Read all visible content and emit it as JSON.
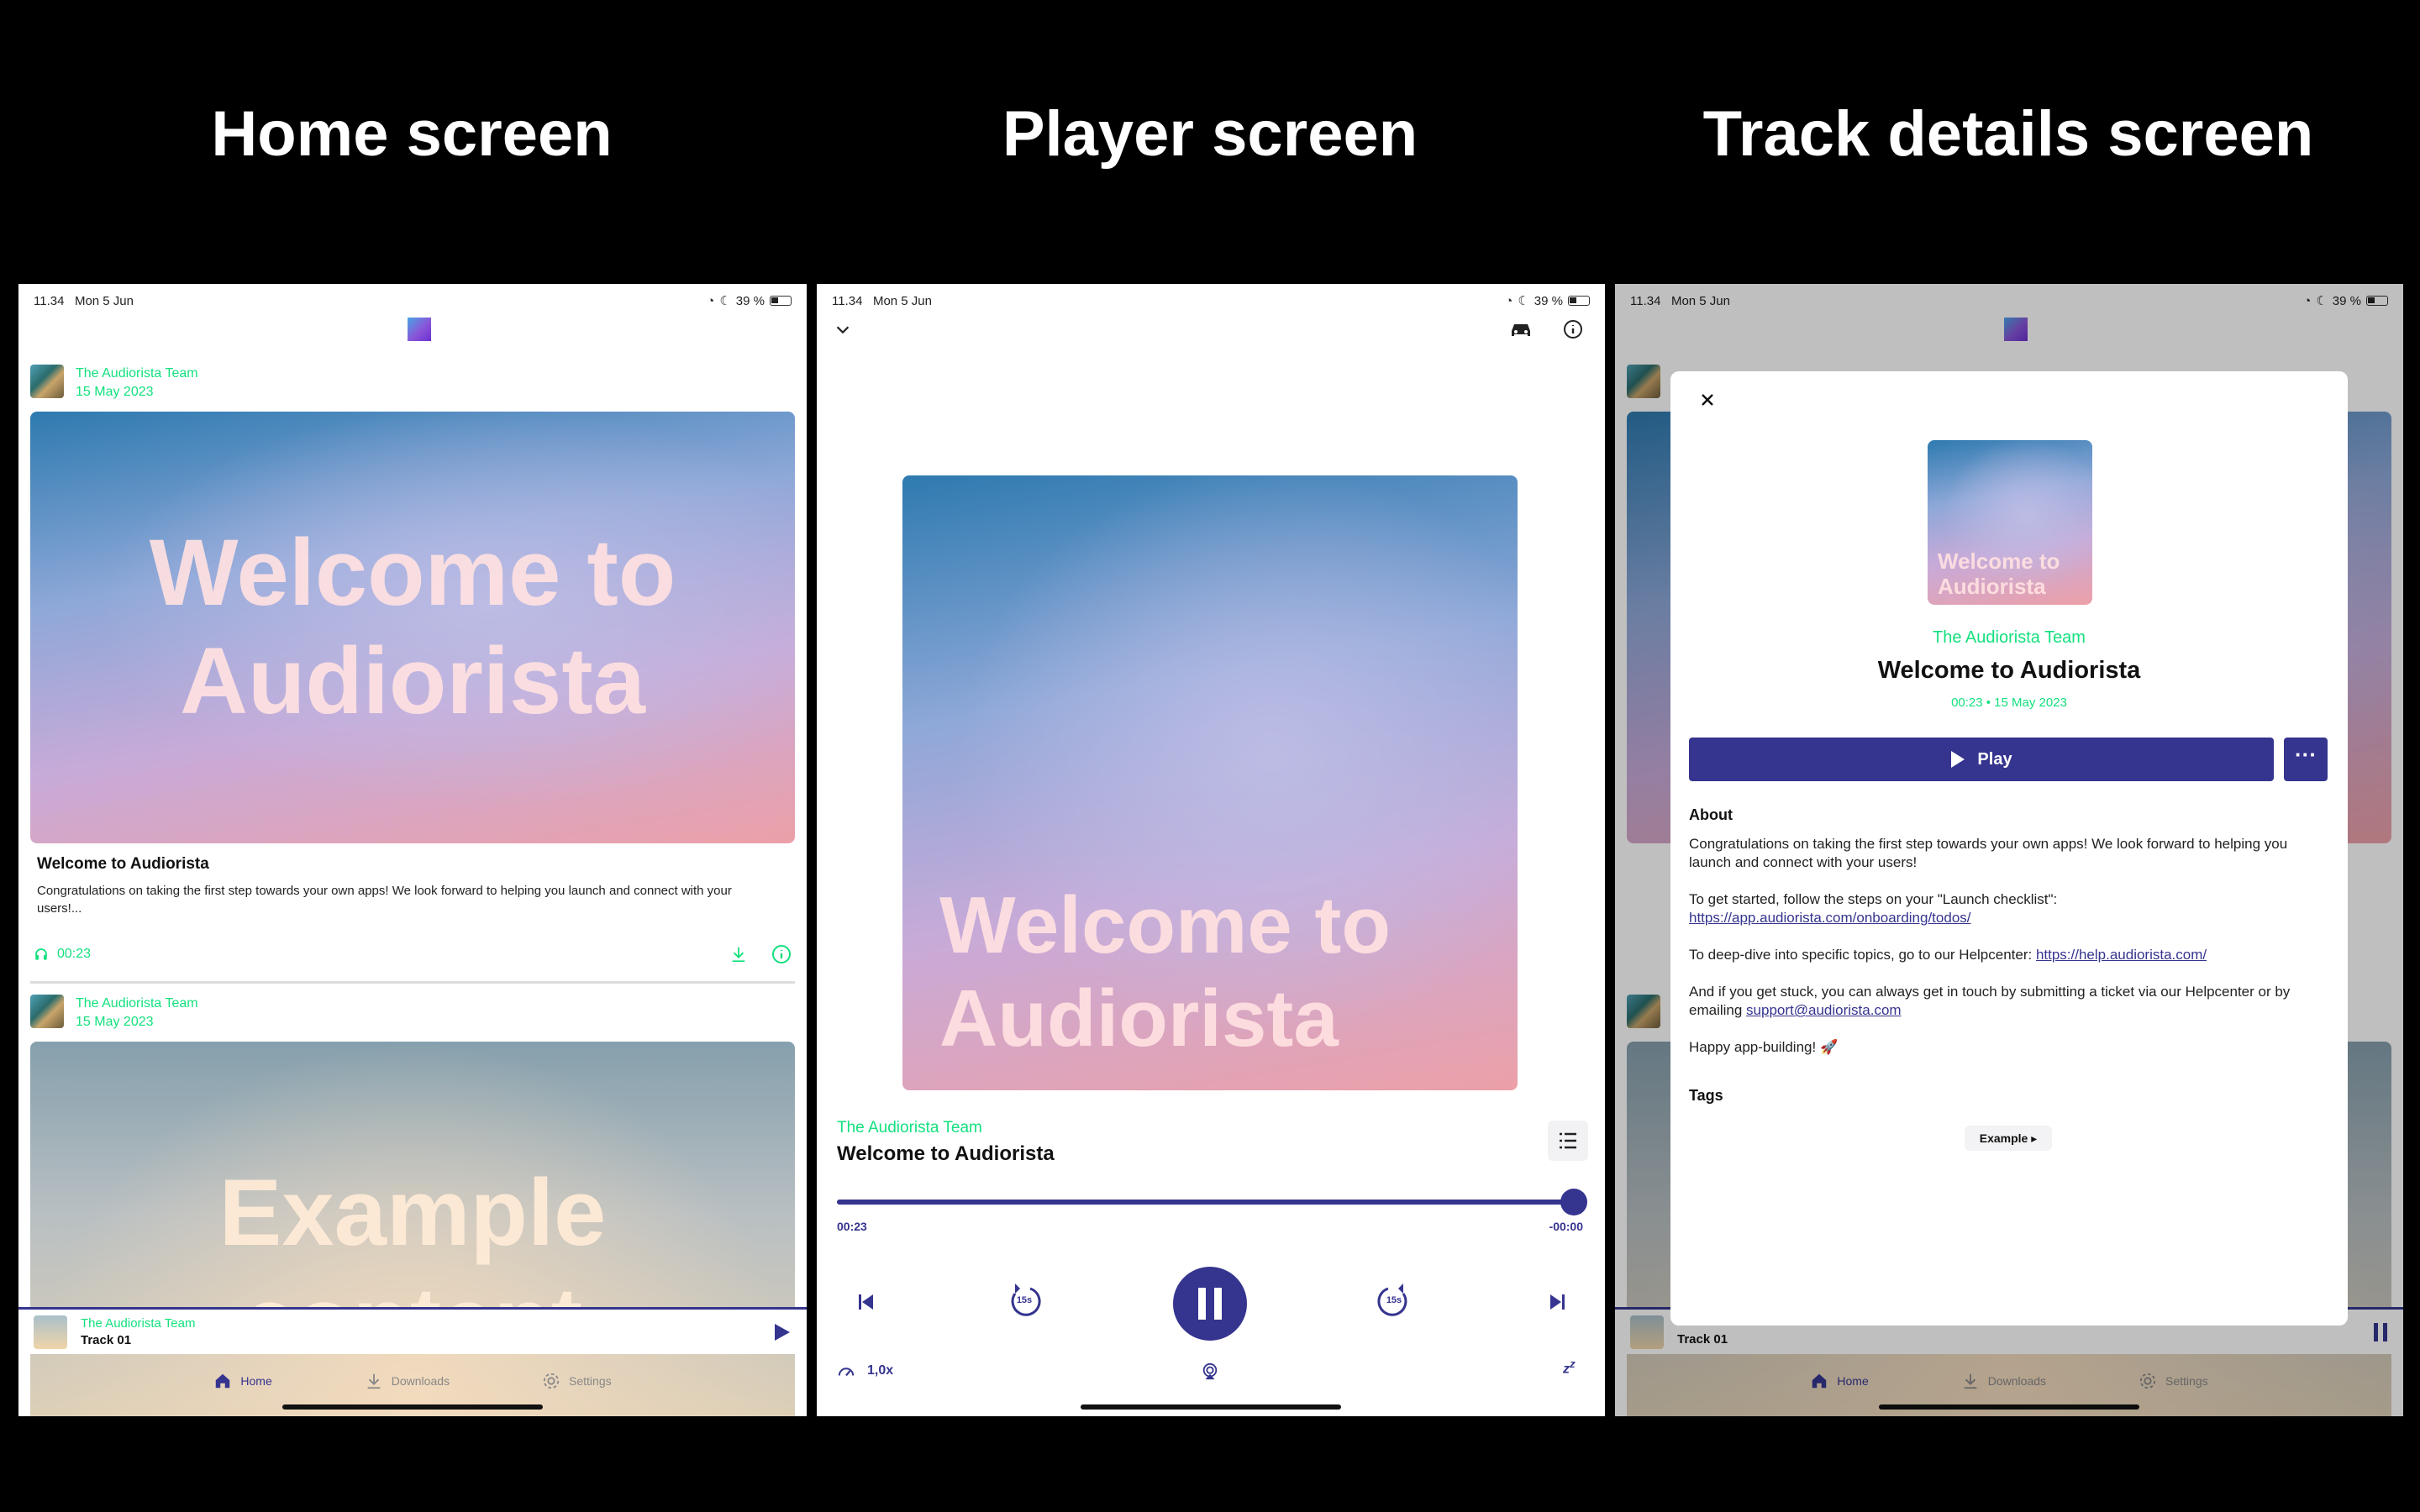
{
  "headings": {
    "home": "Home screen",
    "player": "Player screen",
    "details": "Track details screen"
  },
  "status_bar": {
    "time": "11.34",
    "date": "Mon 5 Jun",
    "battery": "39 %"
  },
  "home": {
    "posts": [
      {
        "author": "The Audiorista Team",
        "date": "15 May 2023",
        "cover_text": "Welcome to Audiorista",
        "title": "Welcome to Audiorista",
        "description": "Congratulations on taking the first step towards your own apps! We look forward to helping you launch and connect with your users!...",
        "duration": "00:23"
      },
      {
        "author": "The Audiorista Team",
        "date": "15 May 2023",
        "cover_text": "Example content"
      }
    ]
  },
  "mini_player": {
    "author": "The Audiorista Team",
    "track": "Track 01"
  },
  "tabs": [
    {
      "label": "Home",
      "icon": "home-icon"
    },
    {
      "label": "Downloads",
      "icon": "download-icon"
    },
    {
      "label": "Settings",
      "icon": "gear-icon"
    }
  ],
  "player": {
    "cover_text": "Welcome to Audiorista",
    "author": "The Audiorista Team",
    "title": "Welcome to Audiorista",
    "elapsed": "00:23",
    "remaining": "-00:00",
    "progress": 0.99,
    "speed": "1,0x",
    "skip_back_label": "15s",
    "skip_forward_label": "15s"
  },
  "details": {
    "cover_text": "Welcome to Audiorista",
    "author": "The Audiorista Team",
    "title": "Welcome to Audiorista",
    "meta": "00:23 • 15 May 2023",
    "play_label": "Play",
    "about_heading": "About",
    "about_p1": "Congratulations on taking the first step towards your own apps! We look forward to helping you launch and connect with your users!",
    "about_p2_prefix": "To get started, follow the steps on your \"Launch checklist\": ",
    "about_p2_link": "https://app.audiorista.com/onboarding/todos/",
    "about_p3_prefix": "To deep-dive into specific topics, go to our Helpcenter: ",
    "about_p3_link": "https://help.audiorista.com/",
    "about_p4_prefix": "And if you get stuck, you can always get in touch by submitting a ticket via our Helpcenter or by emailing ",
    "about_p4_link": "support@audiorista.com",
    "about_p5": "Happy app-building! 🚀",
    "tags_heading": "Tags",
    "tag": "Example ▸"
  },
  "colors": {
    "accent": "#35348f",
    "green": "#13e07e"
  }
}
